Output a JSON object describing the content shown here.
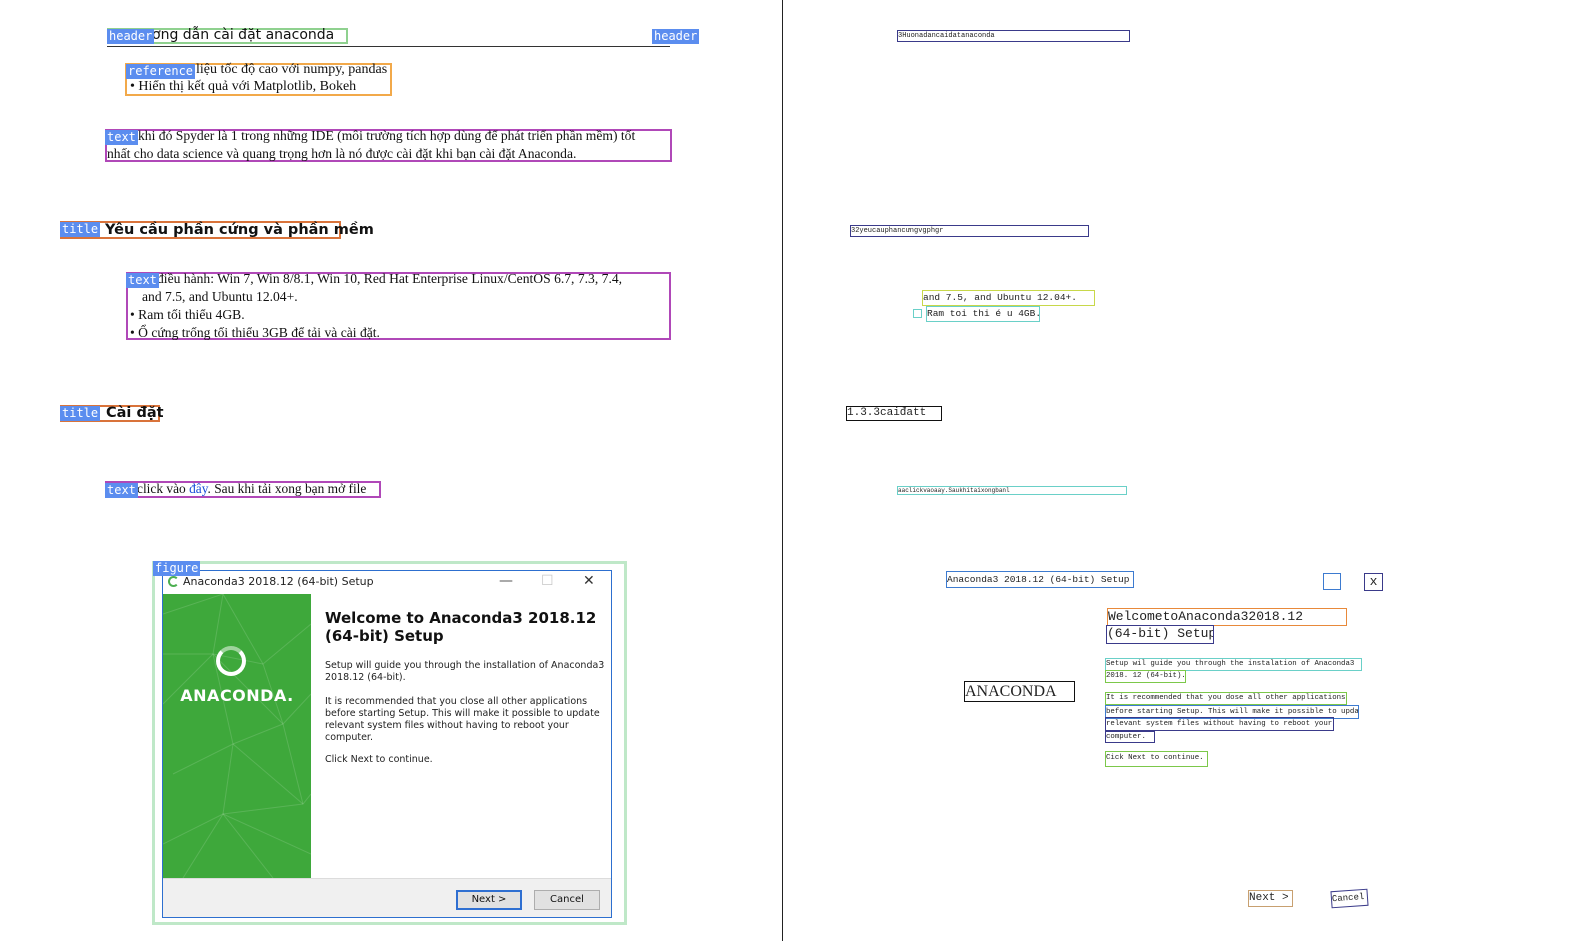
{
  "left": {
    "header": {
      "tag": "header",
      "text": "ơng dẫn cài đặt anaconda",
      "tag_right": "header"
    },
    "reference": {
      "tag": "reference",
      "line1": "liệu tốc độ cao với numpy, pandas",
      "line2": "•  Hiển thị kết quả với Matplotlib, Bokeh"
    },
    "text1": {
      "tag": "text",
      "line1": "khi đó Spyder là 1 trong những IDE (môi trường tích hợp dùng để phát triển phần mềm) tốt",
      "line2": "nhất cho data science và quang trọng hơn là nó được cài đặt khi bạn cài đặt Anaconda."
    },
    "title1": {
      "tag": "title",
      "text": "Yêu cầu phần cứng và phần mềm"
    },
    "text2": {
      "tag": "text",
      "line1": "điều hành: Win 7, Win 8/8.1, Win 10, Red Hat Enterprise Linux/CentOS 6.7, 7.3, 7.4,",
      "line2": "and 7.5, and Ubuntu 12.04+.",
      "line3": "•  Ram tối thiểu 4GB.",
      "line4": "•  Ổ cứng trống tối thiểu 3GB để tải và cài đặt."
    },
    "title2": {
      "tag": "title",
      "text": "Cài đặt"
    },
    "text3": {
      "tag": "text",
      "before": "click vào ",
      "link": "đây",
      "after": ". Sau khi tải xong bạn mở file"
    },
    "figure": {
      "tag": "figure",
      "window_title": "Anaconda3 2018.12 (64-bit) Setup",
      "minimize": "—",
      "maximize": "☐",
      "close": "✕",
      "logo": "ANACONDA.",
      "heading1": "Welcome to Anaconda3 2018.12",
      "heading2": "(64-bit) Setup",
      "p1_l1": "Setup will guide you through the installation of Anaconda3",
      "p1_l2": "2018.12 (64-bit).",
      "p2_l1": "It is recommended that you close all other applications",
      "p2_l2": "before starting Setup. This will make it possible to update",
      "p2_l3": "relevant system files without having to reboot your",
      "p2_l4": "computer.",
      "p3": "Click Next to continue.",
      "next_button": "Next >",
      "cancel_button": "Cancel"
    }
  },
  "right": {
    "header": "3Huonadancaidatanaconda",
    "title1": "32yeucauphancưngvgphgr",
    "text2_line2": "and 7.5,  and Ubuntu 12.04+.",
    "text2_line3": "Ram toi thi é u 4GB.",
    "title2": "1.3.3caiđatt",
    "text3": "aaclickvaoaay.Saukhitaixongbanl",
    "figure_title": "Anaconda3 2018.12 (64-bit) Setup",
    "figure_x": "x",
    "heading1": "WelcometoAnaconda32018.12",
    "heading2": "(64-bit) Setup",
    "p1_l1": "Setup wil guide you through the instalation of Anaconda3",
    "p1_l2": "2018. 12 (64-bit).",
    "p2_l1": "It is recommended that you dose all other applications",
    "p2_l2": "before starting Setup. This will make it possible to update",
    "p2_l3": "relevant system files without having to reboot your",
    "p2_l4": "computer.",
    "p3": "Cick Next to continue.",
    "logo": "ANACONDA",
    "next": "Next >",
    "cancel": "Cancel"
  }
}
